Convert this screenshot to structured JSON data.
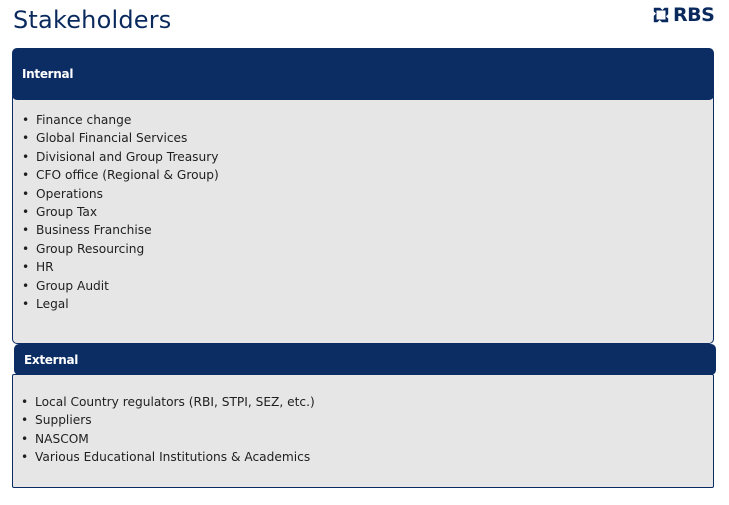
{
  "page": {
    "title": "Stakeholders",
    "logo_text": "RBS",
    "logo_icon": "rbs-daisy-wheel-icon",
    "colors": {
      "brand_navy": "#0b2d63",
      "panel_bg": "#e6e6e6"
    }
  },
  "internal": {
    "header": "Internal",
    "items": [
      "Finance change",
      "Global Financial Services",
      "Divisional and Group Treasury",
      "CFO office (Regional & Group)",
      "Operations",
      "Group Tax",
      "Business Franchise",
      "Group Resourcing",
      "HR",
      "Group Audit",
      "Legal"
    ]
  },
  "external": {
    "header": "External",
    "items": [
      "Local Country regulators (RBI, STPI, SEZ, etc.)",
      "Suppliers",
      "NASCOM",
      "Various Educational Institutions & Academics"
    ]
  }
}
